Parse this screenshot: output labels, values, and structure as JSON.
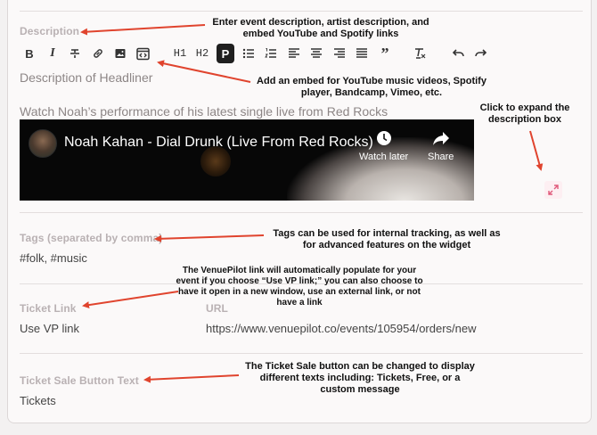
{
  "description": {
    "label": "Description",
    "placeholder": "Description of Headliner",
    "content": "Watch Noah’s performance of his latest single live from Red Rocks"
  },
  "toolbar": {
    "items": [
      {
        "name": "bold",
        "text": "B"
      },
      {
        "name": "italic",
        "text": "I"
      },
      {
        "name": "strikethrough",
        "text": ""
      },
      {
        "name": "link",
        "text": ""
      },
      {
        "name": "image",
        "text": ""
      },
      {
        "name": "embed",
        "text": ""
      },
      {
        "name": "heading-1",
        "text": "H1"
      },
      {
        "name": "heading-2",
        "text": "H2"
      },
      {
        "name": "paragraph",
        "text": "P",
        "active": true
      },
      {
        "name": "bullet-list",
        "text": ""
      },
      {
        "name": "numbered-list",
        "text": ""
      },
      {
        "name": "align-left",
        "text": ""
      },
      {
        "name": "align-center",
        "text": ""
      },
      {
        "name": "align-right",
        "text": ""
      },
      {
        "name": "justify",
        "text": ""
      },
      {
        "name": "quote",
        "text": ""
      },
      {
        "name": "clear-format",
        "text": ""
      },
      {
        "name": "undo",
        "text": ""
      },
      {
        "name": "redo",
        "text": ""
      }
    ]
  },
  "video": {
    "title": "Noah Kahan - Dial Drunk (Live From Red Rocks)",
    "watch_later": "Watch later",
    "share": "Share"
  },
  "tags": {
    "label": "Tags (separated by comma)",
    "value": "#folk, #music"
  },
  "ticket_link": {
    "label": "Ticket Link",
    "value": "Use VP link",
    "url_label": "URL",
    "url_value": "https://www.venuepilot.co/events/105954/orders/new"
  },
  "ticket_sale": {
    "label": "Ticket Sale Button Text",
    "value": "Tickets"
  },
  "annotations": {
    "description": "Enter event description, artist description, and embed YouTube and Spotify links",
    "embed": "Add an embed for YouTube music videos, Spotify player, Bandcamp, Vimeo, etc.",
    "expand": "Click to expand the description box",
    "tags": "Tags can be used for internal tracking, as well as for advanced features on the widget",
    "ticket_link": "The VenuePilot link will automatically populate for your event if you choose “Use VP link;” you can also choose to have it open in a new window, use an external link, or not have a link",
    "ticket_sale": "The Ticket Sale button can be changed to display different texts including: Tickets, Free, or a custom message"
  },
  "colors": {
    "arrow": "#e0442e",
    "label": "#b9b1b3",
    "accent_pink": "#e05a7a"
  }
}
